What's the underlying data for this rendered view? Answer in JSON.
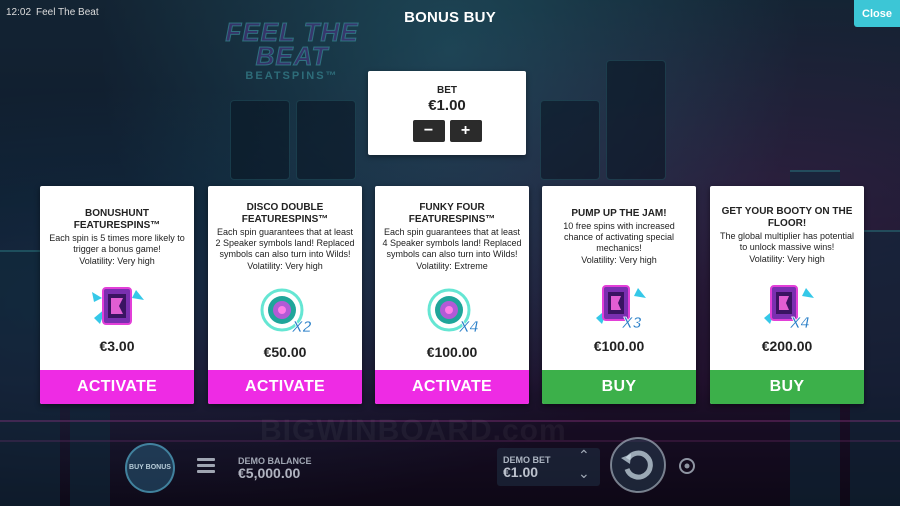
{
  "status_bar": {
    "time": "12:02",
    "app_title": "Feel The Beat"
  },
  "page": {
    "title": "BONUS BUY",
    "close_label": "Close"
  },
  "background_logo": {
    "main": "FEEL THE BEAT",
    "sub": "BEATSPINS™"
  },
  "bet": {
    "label": "BET",
    "value": "€1.00",
    "decrease_label": "−",
    "increase_label": "+"
  },
  "cards": [
    {
      "title": "BONUSHUNT FEATURESPINS™",
      "description": "Each spin is 5 times more likely to trigger a bonus game!",
      "volatility": "Volatility: Very high",
      "icon": "speaker-symbol-icon",
      "price": "€3.00",
      "action_label": "ACTIVATE",
      "action_color": "#ee2be4"
    },
    {
      "title": "DISCO DOUBLE FEATURESPINS™",
      "description": "Each spin guarantees that at least 2 Speaker symbols land! Replaced symbols can also turn into Wilds!",
      "volatility": "Volatility: Very high",
      "icon": "disco-x2-icon",
      "icon_label": "X2",
      "price": "€50.00",
      "action_label": "ACTIVATE",
      "action_color": "#ee2be4"
    },
    {
      "title": "FUNKY FOUR FEATURESPINS™",
      "description": "Each spin guarantees that at least 4 Speaker symbols land! Replaced symbols can also turn into Wilds!",
      "volatility": "Volatility: Extreme",
      "icon": "disco-x4-icon",
      "icon_label": "X4",
      "price": "€100.00",
      "action_label": "ACTIVATE",
      "action_color": "#ee2be4"
    },
    {
      "title": "PUMP UP THE JAM!",
      "description": "10 free spins with increased chance of activating special mechanics!",
      "volatility": "Volatility: Very high",
      "icon": "speaker-x3-icon",
      "icon_label": "X3",
      "price": "€100.00",
      "action_label": "BUY",
      "action_color": "#3cb04a"
    },
    {
      "title": "GET YOUR BOOTY ON THE FLOOR!",
      "description": "The global multiplier has potential to unlock massive wins!",
      "volatility": "Volatility: Very high",
      "icon": "speaker-x4-icon",
      "icon_label": "X4",
      "price": "€200.00",
      "action_label": "BUY",
      "action_color": "#3cb04a"
    }
  ],
  "bottom_bar": {
    "buy_bonus_label": "BUY BONUS",
    "balance_label": "DEMO BALANCE",
    "balance_value": "€5,000.00",
    "bet_label": "DEMO BET",
    "bet_value": "€1.00"
  },
  "watermark": "BIGWINBOARD.com"
}
